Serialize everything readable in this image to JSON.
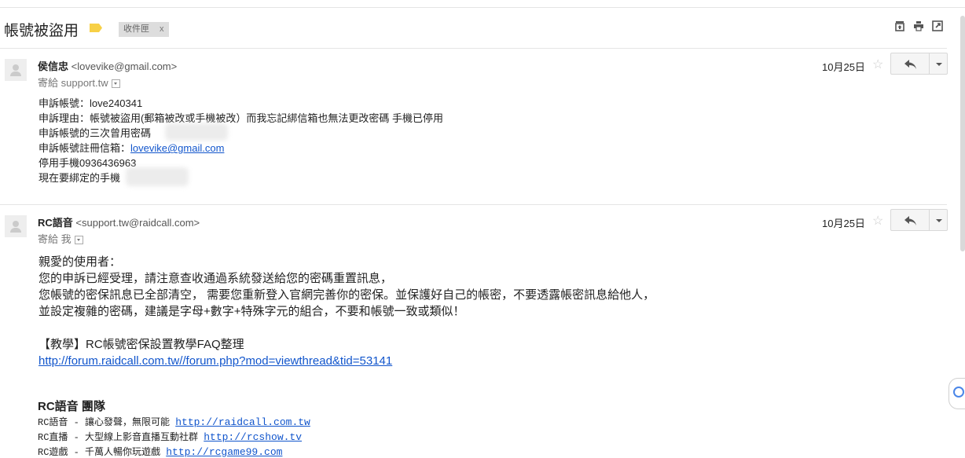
{
  "thread": {
    "subject": "帳號被盜用",
    "label_chip": "收件匣",
    "label_chip_close": "x"
  },
  "toolbar_icons": [
    "archive-icon",
    "print-icon",
    "new-window-icon"
  ],
  "messages": [
    {
      "sender_name": "侯信忠",
      "sender_email": "<lovevike@gmail.com>",
      "to_prefix": "寄給",
      "to": "support.tw",
      "date": "10月25日",
      "body": {
        "line1": "申訴帳號：love240341",
        "line2": "申訴理由：帳號被盜用(郵箱被改或手機被改）而我忘記綁信箱也無法更改密碼 手機已停用",
        "line3": "申訴帳號的三次曾用密碼",
        "line4_prefix": "申訴帳號註冊信箱：",
        "line4_link": "lovevike@gmail.com",
        "line5": "停用手機0936436963",
        "line6": "現在要綁定的手機"
      }
    },
    {
      "sender_name": "RC語音",
      "sender_email": "<support.tw@raidcall.com>",
      "to_prefix": "寄給",
      "to": "我",
      "date": "10月25日",
      "body": {
        "line1": "親愛的使用者：",
        "line2": "您的申訴已經受理，請注意查收通過系統發送給您的密碼重置訊息，",
        "line3": "您帳號的密保訊息已全部清空， 需要您重新登入官網完善你的密保。並保護好自己的帳密，不要透露帳密訊息給他人，",
        "line4": "並設定複雜的密碼，建議是字母+數字+特殊字元的組合，不要和帳號一致或類似！",
        "line5": "【教學】RC帳號密保設置教學FAQ整理",
        "link": "http://forum.raidcall.com.tw//forum.php?mod=viewthread&tid=53141",
        "team": "RC語音 團隊",
        "sig1_text": "RC語音 - 讓心發聲，無限可能",
        "sig1_link": "http://raidcall.com.tw",
        "sig2_text": "RC直播 - 大型線上影音直播互動社群",
        "sig2_link": "http://rcshow.tv",
        "sig3_text": "RC遊戲 - 千萬人暢你玩遊戲",
        "sig3_link": "http://rcgame99.com"
      }
    }
  ],
  "star_glyph": "☆"
}
